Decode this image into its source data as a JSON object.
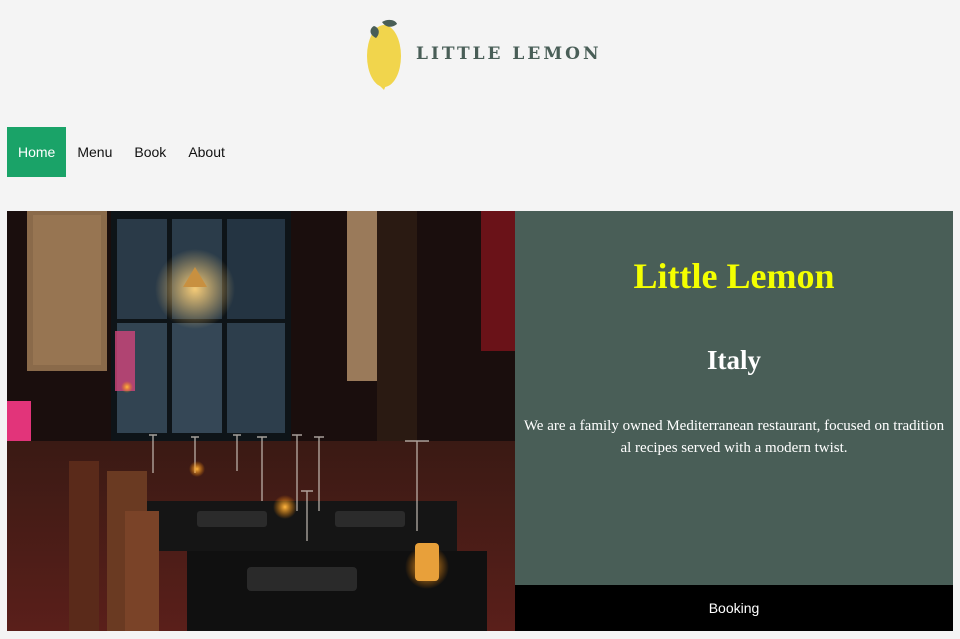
{
  "brand": {
    "name": "LITTLE LEMON",
    "logo_icon": "lemon-icon",
    "colors": {
      "primary_green": "#495e57",
      "accent_yellow": "#f4ff00",
      "nav_active": "#1aa368"
    }
  },
  "nav": {
    "items": [
      {
        "label": "Home",
        "active": true
      },
      {
        "label": "Menu",
        "active": false
      },
      {
        "label": "Book",
        "active": false
      },
      {
        "label": "About",
        "active": false
      }
    ]
  },
  "hero": {
    "title": "Little Lemon",
    "subtitle": "Italy",
    "description": "We are a family owned Mediterranean restaurant, focused on traditional recipes served with a modern twist.",
    "booking_label": "Booking"
  }
}
